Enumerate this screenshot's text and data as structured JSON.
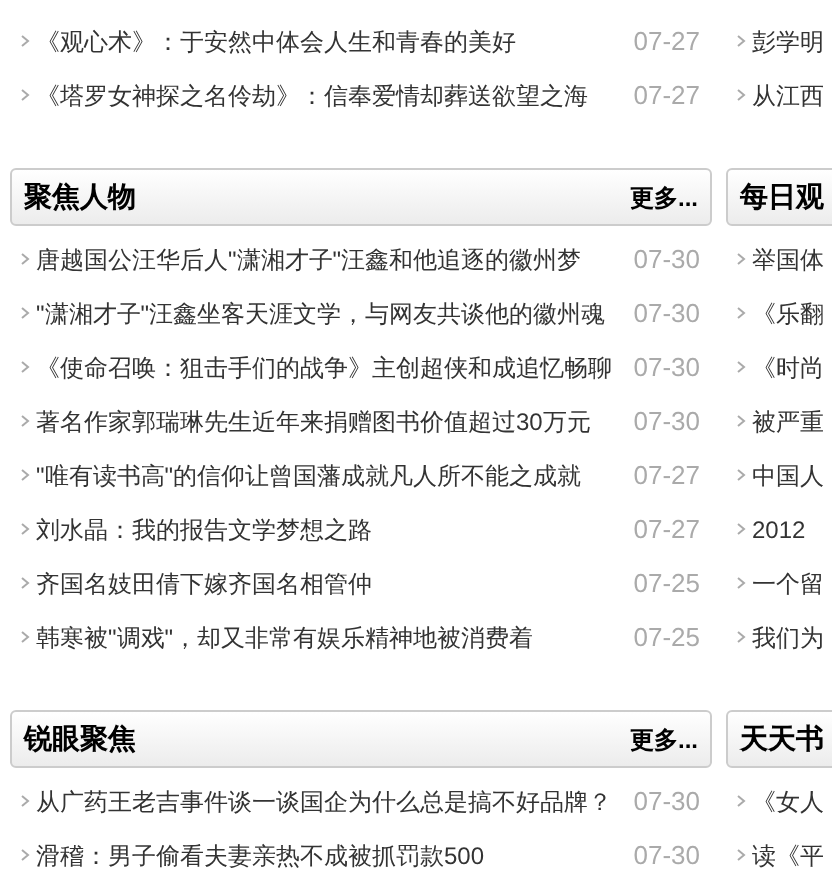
{
  "columns": [
    {
      "blocks": [
        {
          "kind": "list",
          "items": [
            {
              "text": "《观心术》：于安然中体会人生和青春的美好",
              "date": "07-27"
            },
            {
              "text": "《塔罗女神探之名伶劫》：信奉爱情却葬送欲望之海",
              "date": "07-27"
            }
          ]
        },
        {
          "kind": "panel",
          "title": "聚焦人物",
          "more": "更多...",
          "items": [
            {
              "text": "唐越国公汪华后人\"潇湘才子\"汪鑫和他追逐的徽州梦",
              "date": "07-30"
            },
            {
              "text": "\"潇湘才子\"汪鑫坐客天涯文学，与网友共谈他的徽州魂",
              "date": "07-30"
            },
            {
              "text": "《使命召唤：狙击手们的战争》主创超侠和成追忆畅聊",
              "date": "07-30"
            },
            {
              "text": "著名作家郭瑞琳先生近年来捐赠图书价值超过30万元",
              "date": "07-30"
            },
            {
              "text": "\"唯有读书高\"的信仰让曾国藩成就凡人所不能之成就",
              "date": "07-27"
            },
            {
              "text": "刘水晶：我的报告文学梦想之路",
              "date": "07-27"
            },
            {
              "text": "齐国名妓田倩下嫁齐国名相管仲",
              "date": "07-25"
            },
            {
              "text": "韩寒被\"调戏\"，却又非常有娱乐精神地被消费着",
              "date": "07-25"
            }
          ]
        },
        {
          "kind": "panel",
          "title": "锐眼聚焦",
          "more": "更多...",
          "items": [
            {
              "text": "从广药王老吉事件谈一谈国企为什么总是搞不好品牌？",
              "date": "07-30"
            },
            {
              "text": "滑稽：男子偷看夫妻亲热不成被抓罚款500",
              "date": "07-30"
            }
          ]
        }
      ]
    },
    {
      "blocks": [
        {
          "kind": "list",
          "items": [
            {
              "text": "彭学明"
            },
            {
              "text": "从江西"
            }
          ]
        },
        {
          "kind": "panel",
          "title": "每日观",
          "items": [
            {
              "text": "举国体"
            },
            {
              "text": "《乐翻"
            },
            {
              "text": "《时尚"
            },
            {
              "text": "被严重"
            },
            {
              "text": "中国人"
            },
            {
              "text": "2012"
            },
            {
              "text": "一个留"
            },
            {
              "text": "我们为"
            }
          ]
        },
        {
          "kind": "panel",
          "title": "天天书",
          "items": [
            {
              "text": "《女人"
            },
            {
              "text": "读《平"
            }
          ]
        }
      ]
    }
  ]
}
